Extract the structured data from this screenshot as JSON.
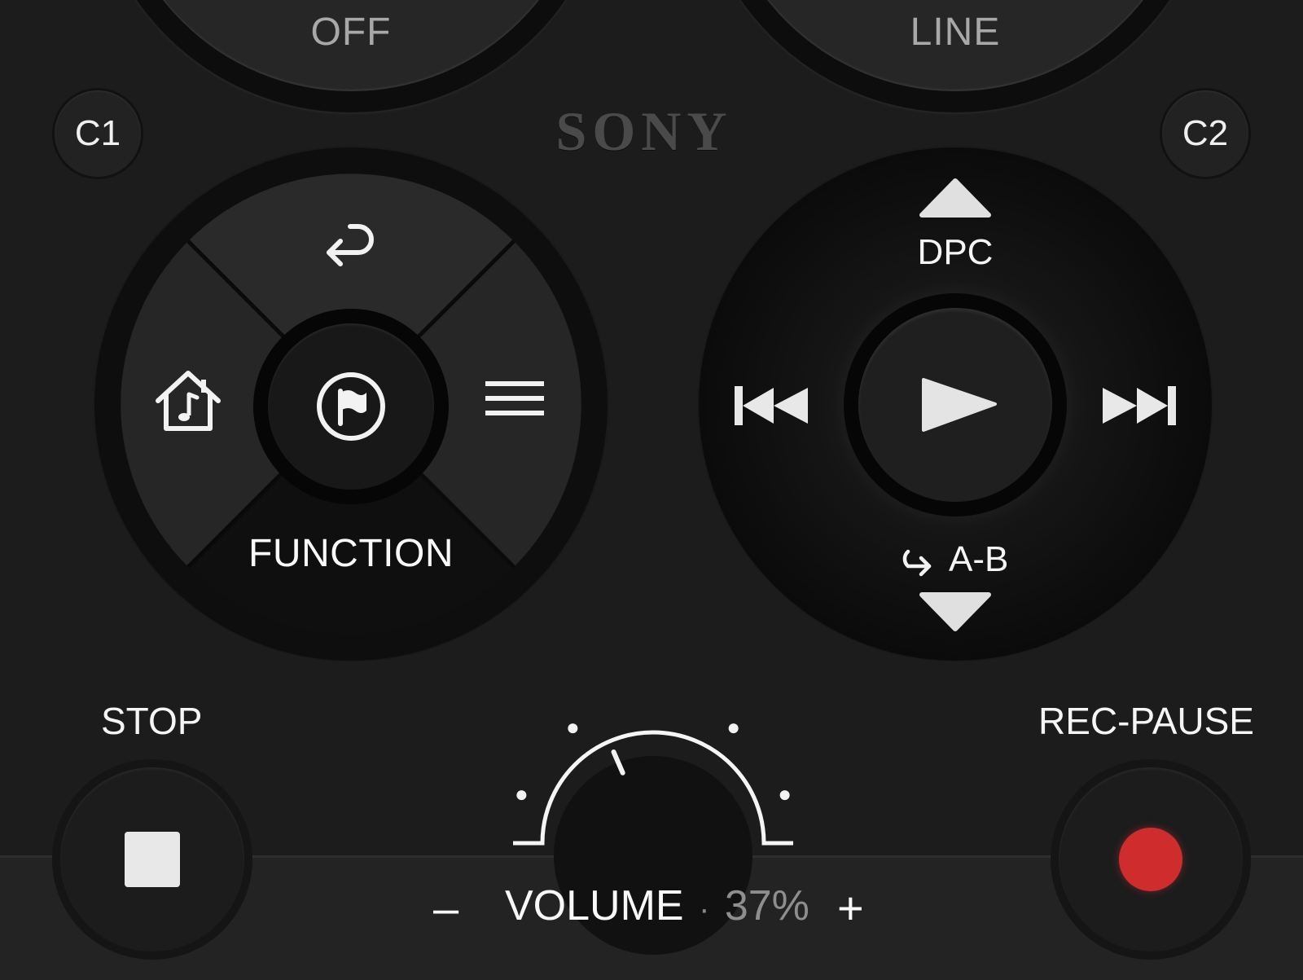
{
  "top_dials": {
    "left_label": "OFF",
    "right_label": "LINE"
  },
  "custom_buttons": {
    "c1": "C1",
    "c2": "C2"
  },
  "brand": "SONY",
  "function_pad": {
    "label": "FUNCTION"
  },
  "transport": {
    "dpc_label": "DPC",
    "ab_label": "A-B"
  },
  "bottom": {
    "stop_label": "STOP",
    "rec_pause_label": "REC-PAUSE",
    "volume_minus": "–",
    "volume_plus": "+",
    "volume_label": "VOLUME",
    "volume_separator": "·",
    "volume_value": "37%",
    "volume_level": 0.37
  },
  "colors": {
    "background": "#1c1c1c",
    "rec_red": "#cf2d2d",
    "text": "#f0f0f0",
    "muted": "#a8a8a8"
  },
  "icons": {
    "function_up": "return-arrow-icon",
    "function_left": "home-music-icon",
    "function_right": "menu-lines-icon",
    "function_center": "flag-circle-icon",
    "transport_up": "triangle-up-icon",
    "transport_down": "triangle-down-icon",
    "transport_prev": "skip-previous-icon",
    "transport_next": "skip-next-icon",
    "transport_center": "play-icon",
    "repeat": "repeat-arrow-icon"
  }
}
